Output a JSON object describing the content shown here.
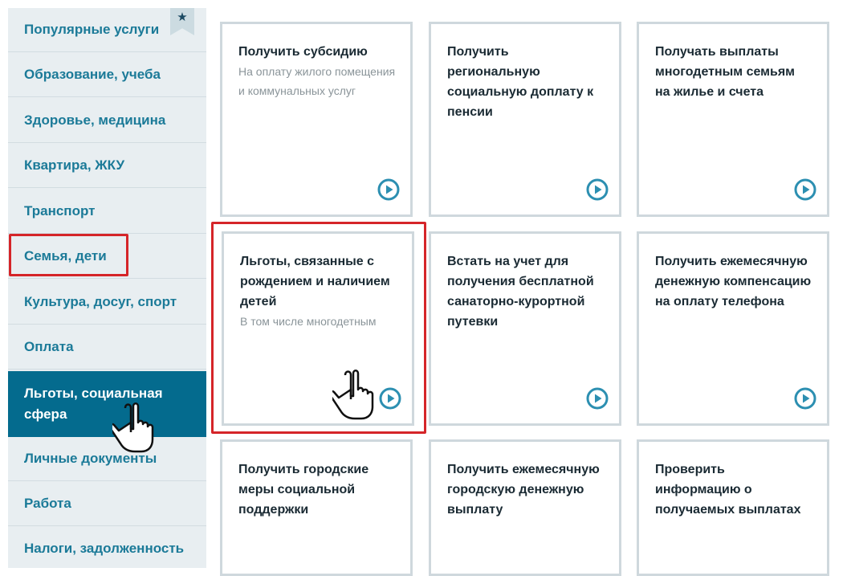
{
  "sidebar": {
    "items": [
      {
        "label": "Популярные услуги"
      },
      {
        "label": "Образование, учеба"
      },
      {
        "label": "Здоровье, медицина"
      },
      {
        "label": "Квартира, ЖКУ"
      },
      {
        "label": "Транспорт"
      },
      {
        "label": "Семья, дети"
      },
      {
        "label": "Культура, досуг, спорт"
      },
      {
        "label": "Оплата"
      },
      {
        "label": "Льготы, социальная сфера"
      },
      {
        "label": "Личные документы"
      },
      {
        "label": "Работа"
      },
      {
        "label": "Налоги, задолженность"
      }
    ],
    "bookmark_icon": "★",
    "active_item": "Льготы, социальная сфера"
  },
  "cards": [
    {
      "title": "Получить субсидию",
      "subtitle": "На оплату жилого помещения и коммунальных услуг"
    },
    {
      "title": "Получить региональную социальную доплату к пенсии",
      "subtitle": ""
    },
    {
      "title": "Получать выплаты многодетным семьям на жилье и счета",
      "subtitle": ""
    },
    {
      "title": "Льготы, связанные с рождением и наличием детей",
      "subtitle": "В том числе многодетным"
    },
    {
      "title": "Встать на учет для получения бесплатной санаторно-курортной путевки",
      "subtitle": ""
    },
    {
      "title": "Получить ежемесячную денежную компенсацию на оплату телефона",
      "subtitle": ""
    },
    {
      "title": "Получить городские меры социальной поддержки",
      "subtitle": ""
    },
    {
      "title": "Получить ежемесячную городскую денежную выплату",
      "subtitle": ""
    },
    {
      "title": "Проверить информацию о получаемых выплатах",
      "subtitle": ""
    }
  ],
  "colors": {
    "accent": "#1b7a98",
    "active_bg": "#046b8e",
    "highlight": "#d52529"
  }
}
